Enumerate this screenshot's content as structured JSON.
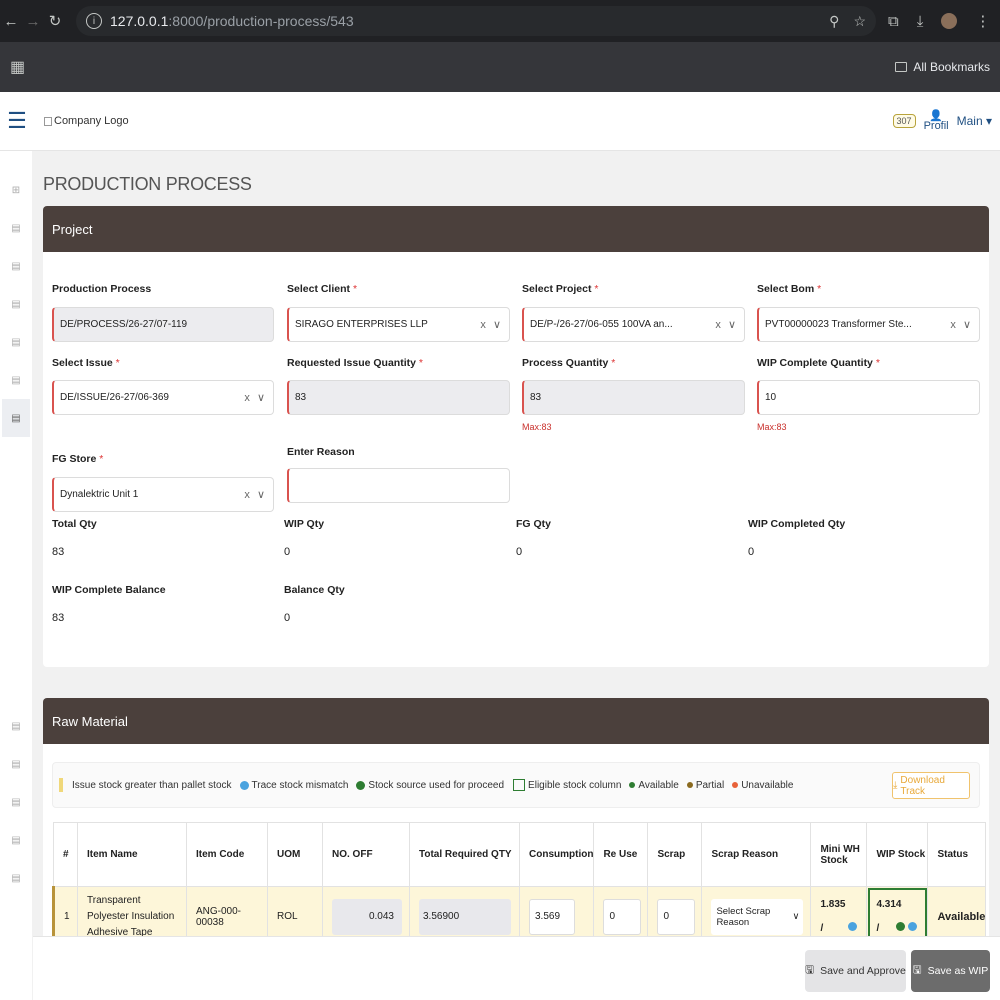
{
  "browser": {
    "url_host": "127.0.0.1",
    "url_path": ":8000/production-process/543",
    "bookmarks": "All Bookmarks"
  },
  "header": {
    "logo_alt": "Company Logo",
    "notif_count": "307",
    "profile": "Profil",
    "main_menu": "Main"
  },
  "page": {
    "title": "PRODUCTION PROCESS"
  },
  "project": {
    "header": "Project",
    "fields": {
      "production_process": {
        "label": "Production Process",
        "value": "DE/PROCESS/26-27/07-119"
      },
      "client": {
        "label": "Select Client",
        "value": "SIRAGO ENTERPRISES LLP"
      },
      "project": {
        "label": "Select Project",
        "value": "DE/P-/26-27/06-055 100VA an..."
      },
      "bom": {
        "label": "Select Bom",
        "value": "PVT00000023 Transformer Ste..."
      },
      "issue": {
        "label": "Select Issue",
        "value": "DE/ISSUE/26-27/06-369"
      },
      "requested_qty": {
        "label": "Requested Issue Quantity",
        "value": "83"
      },
      "process_qty": {
        "label": "Process Quantity",
        "value": "83",
        "hint": "Max:83"
      },
      "wip_complete_qty": {
        "label": "WIP Complete Quantity",
        "value": "10",
        "hint": "Max:83"
      },
      "fg_store": {
        "label": "FG Store",
        "value": "Dynalektric Unit 1"
      },
      "reason": {
        "label": "Enter Reason",
        "value": ""
      }
    },
    "stats": {
      "total_qty": {
        "label": "Total Qty",
        "value": "83"
      },
      "wip_qty": {
        "label": "WIP Qty",
        "value": "0"
      },
      "fg_qty": {
        "label": "FG Qty",
        "value": "0"
      },
      "wip_completed_qty": {
        "label": "WIP Completed Qty",
        "value": "0"
      },
      "wip_complete_balance": {
        "label": "WIP Complete Balance",
        "value": "83"
      },
      "balance_qty": {
        "label": "Balance Qty",
        "value": "0"
      }
    }
  },
  "raw_material": {
    "header": "Raw Material",
    "legend": {
      "issue": "Issue stock greater than pallet stock",
      "trace": "Trace stock mismatch",
      "source": "Stock source used for proceed",
      "eligible": "Eligible stock column",
      "available": "Available",
      "partial": "Partial",
      "unavailable": "Unavailable"
    },
    "download": "Download Track",
    "columns": {
      "idx": "#",
      "item_name": "Item Name",
      "item_code": "Item Code",
      "uom": "UOM",
      "no_off": "NO. OFF",
      "total_req": "Total Required QTY",
      "consumption": "Consumption",
      "reuse": "Re Use",
      "scrap": "Scrap",
      "scrap_reason": "Scrap Reason",
      "mini_wh": "Mini WH Stock",
      "wip_stock": "WIP Stock",
      "status": "Status"
    },
    "row": {
      "idx": "1",
      "item_name": "Transparent Polyester Insulation Adhesive Tape",
      "item_code": "ANG-000-00038",
      "uom": "ROL",
      "no_off": "0.043",
      "total_req": "3.56900",
      "consumption": "3.569",
      "reuse": "0",
      "scrap": "0",
      "scrap_reason": "Select Scrap Reason",
      "mini_wh": "1.835",
      "mini_wh_sep": "/",
      "wip_stock": "4.314",
      "wip_sep": "/",
      "status": "Available"
    }
  },
  "footer": {
    "approve": "Save and Approve",
    "wip": "Save as WIP"
  },
  "colors": {
    "card_header": "#4b403c",
    "required": "#d9534f",
    "row_highlight": "#fdf6d9"
  }
}
